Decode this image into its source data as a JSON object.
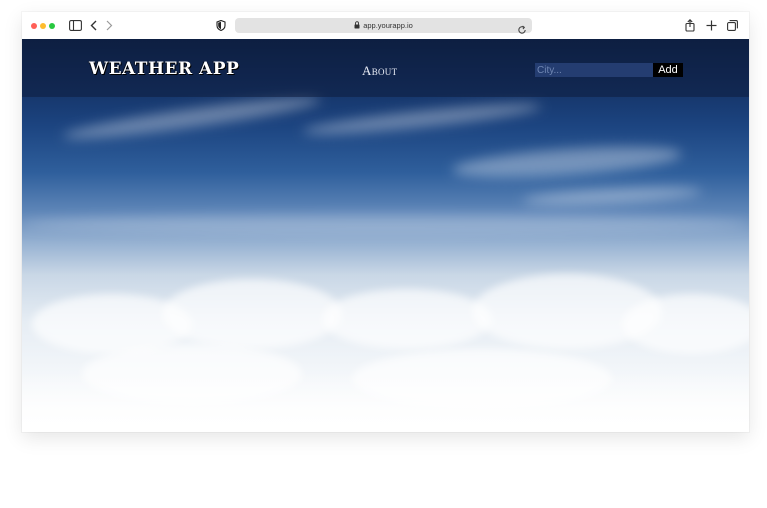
{
  "browser": {
    "url": "app.yourapp.io",
    "icons": [
      "sidebar-icon",
      "back-arrow-icon",
      "forward-arrow-icon",
      "shield-icon",
      "lock-icon",
      "reload-icon",
      "share-icon",
      "plus-icon",
      "tabs-icon"
    ]
  },
  "app": {
    "brand": "WEATHER APP",
    "nav": {
      "about": "About"
    },
    "search": {
      "placeholder": "City...",
      "value": ""
    },
    "add_label": "Add"
  },
  "colors": {
    "nav_background": "#0e1e3e",
    "input_background": "#284278",
    "button_background": "#000000",
    "button_text": "#ffffff"
  }
}
